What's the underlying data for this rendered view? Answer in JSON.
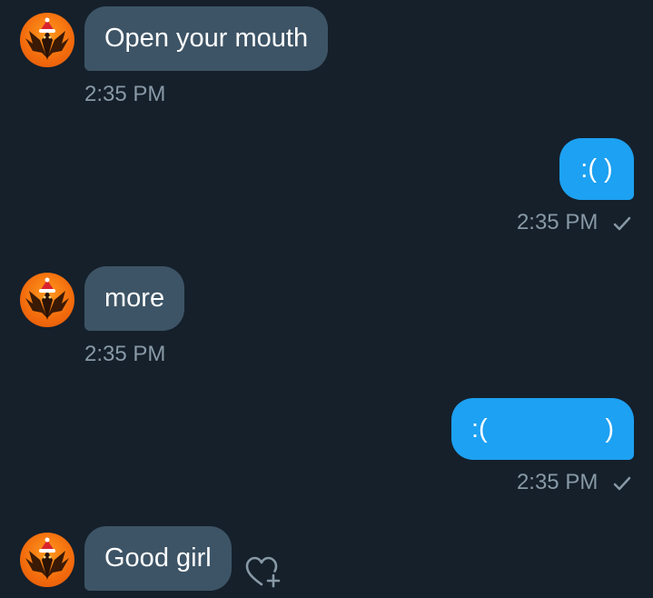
{
  "theme": {
    "background": "#15202b",
    "incoming_bubble": "#3d5466",
    "outgoing_bubble": "#1da1f2",
    "meta_text": "#8899a6",
    "avatar_accent": "#f26a0c"
  },
  "messages": [
    {
      "direction": "incoming",
      "text": "Open your mouth",
      "time": "2:35 PM"
    },
    {
      "direction": "outgoing",
      "text": ":( )",
      "time": "2:35 PM",
      "status_icon": "check-icon"
    },
    {
      "direction": "incoming",
      "text": "more",
      "time": "2:35 PM"
    },
    {
      "direction": "outgoing",
      "text_left": ":(",
      "text_right": ")",
      "time": "2:35 PM",
      "status_icon": "check-icon"
    },
    {
      "direction": "incoming",
      "text": "Good girl",
      "reaction_icon": "heart-plus-icon"
    }
  ]
}
